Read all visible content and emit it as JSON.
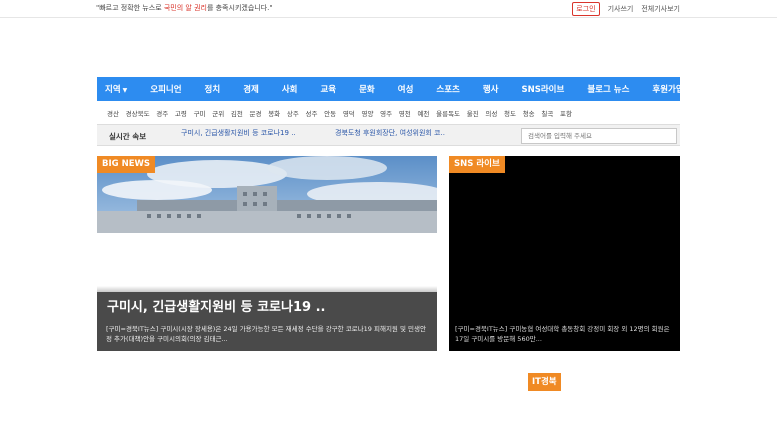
{
  "header": {
    "slogan_prefix": "\"빠르고 정확한 뉴스로 ",
    "slogan_highlight": "국민의 알 권리",
    "slogan_suffix": "를 충족시키겠습니다.\"",
    "login_label": "로그인",
    "write_label": "기사쓰기",
    "all_articles_label": "전체기사보기"
  },
  "main_nav": {
    "items": [
      {
        "label": "지역",
        "has_caret": true
      },
      {
        "label": "오피니언"
      },
      {
        "label": "정치"
      },
      {
        "label": "경제"
      },
      {
        "label": "사회"
      },
      {
        "label": "교육"
      },
      {
        "label": "문화"
      },
      {
        "label": "여성"
      },
      {
        "label": "스포츠"
      },
      {
        "label": "행사"
      },
      {
        "label": "SNS라이브"
      },
      {
        "label": "블로그 뉴스"
      },
      {
        "label": "후원가입"
      }
    ],
    "caret_glyph": "▼"
  },
  "region_nav": {
    "items": [
      "경산",
      "경상북도",
      "경주",
      "고령",
      "구미",
      "군위",
      "김천",
      "문경",
      "봉화",
      "상주",
      "성주",
      "안동",
      "영덕",
      "영양",
      "영주",
      "영천",
      "예천",
      "울릉독도",
      "울진",
      "의성",
      "청도",
      "청송",
      "칠곡",
      "포항"
    ]
  },
  "ticker": {
    "label": "실시간 속보",
    "news_1": "구미시, 긴급생활지원비 등 코로나19 ..",
    "news_2": "경북도청 후원회장단, 여성위원회 코..",
    "search_placeholder": "검색어를 입력해 주세요"
  },
  "big_news": {
    "tag": "BIG NEWS",
    "headline": "구미시, 긴급생활지원비 등 코로나19 ..",
    "summary": "[구미=경북IT뉴스] 구미시(시장 장세용)은 24일 가용가능한 모든 재세정 수단을 강구한 코로나19 피해지원 및 민생안정 추가(대책)안을 구미시의회(의장 김태근..."
  },
  "sns_live": {
    "tag": "SNS 라이브",
    "summary": "[구미=경북IT뉴스] 구미농협 여성대학 총동창회 강정미 회장 외 12명의 회원은 17일 구미시를 방문해 560만..."
  },
  "it_section": {
    "tag": "IT경북"
  },
  "colors": {
    "nav_blue": "#2d8cf0",
    "accent_orange": "#f08a24",
    "highlight_red": "#d9342b",
    "ticker_link": "#2a56a8"
  }
}
